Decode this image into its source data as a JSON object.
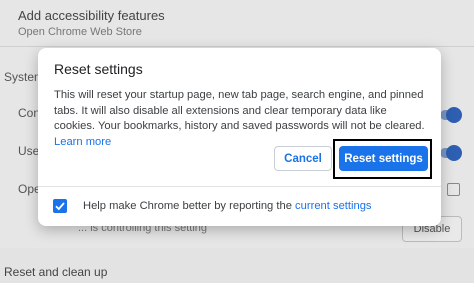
{
  "background": {
    "accessibility_title": "Add accessibility features",
    "accessibility_sub": "Open Chrome Web Store",
    "system_heading": "System",
    "row1_fragment": "Con",
    "row2_fragment": "Use",
    "row3_fragment": "Ope",
    "controlled_text": "... is controlling this setting",
    "disable_label": "Disable",
    "reset_heading": "Reset and clean up"
  },
  "dialog": {
    "title": "Reset settings",
    "body_text": "This will reset your startup page, new tab page, search engine, and pinned tabs. It will also disable all extensions and clear temporary data like cookies. Your bookmarks, history and saved passwords will not be cleared.",
    "learn_more": "Learn more",
    "cancel_label": "Cancel",
    "reset_label": "Reset settings",
    "footer_text": "Help make Chrome better by reporting the",
    "footer_link": "current settings",
    "checkbox_checked": true
  },
  "colors": {
    "accent": "#1a73e8",
    "highlight_box": "#000000"
  }
}
